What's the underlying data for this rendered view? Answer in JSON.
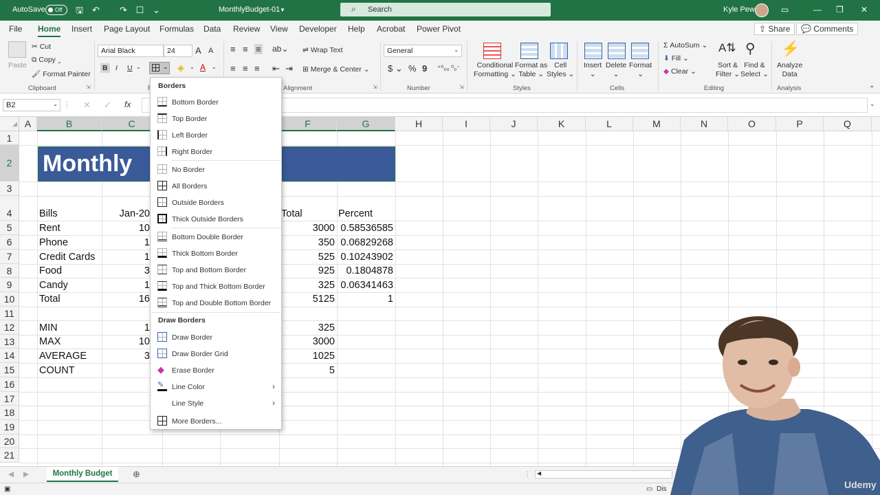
{
  "titlebar": {
    "autosave_label": "AutoSave",
    "autosave_state": "Off",
    "doc_title": "MonthlyBudget-01",
    "search_placeholder": "Search",
    "user": "Kyle Pew"
  },
  "tabs": [
    "File",
    "Home",
    "Insert",
    "Page Layout",
    "Formulas",
    "Data",
    "Review",
    "View",
    "Developer",
    "Help",
    "Acrobat",
    "Power Pivot"
  ],
  "active_tab": "Home",
  "share_label": "Share",
  "comments_label": "Comments",
  "ribbon": {
    "clipboard": {
      "paste": "Paste",
      "cut": "Cut",
      "copy": "Copy",
      "format_painter": "Format Painter",
      "group": "Clipboard"
    },
    "font": {
      "name": "Arial Black",
      "size": "24",
      "group": "F"
    },
    "alignment": {
      "wrap": "Wrap Text",
      "merge": "Merge & Center",
      "group": "Alignment"
    },
    "number": {
      "format": "General",
      "group": "Number"
    },
    "styles": {
      "conditional": "Conditional Formatting",
      "format_table": "Format as Table",
      "cell_styles": "Cell Styles",
      "group": "Styles"
    },
    "cells": {
      "insert": "Insert",
      "delete": "Delete",
      "format": "Format",
      "group": "Cells"
    },
    "editing": {
      "autosum": "AutoSum",
      "fill": "Fill",
      "clear": "Clear",
      "sort": "Sort & Filter",
      "find": "Find & Select",
      "group": "Editing"
    },
    "analysis": {
      "analyze": "Analyze Data",
      "group": "Analysis"
    }
  },
  "namebox": "B2",
  "columns": [
    "A",
    "B",
    "C",
    "F",
    "G",
    "H",
    "I",
    "J",
    "K",
    "L",
    "M",
    "N",
    "O",
    "P",
    "Q"
  ],
  "rows": [
    "1",
    "2",
    "3",
    "4",
    "5",
    "6",
    "7",
    "8",
    "9",
    "10",
    "11",
    "12",
    "13",
    "14",
    "15",
    "16",
    "17",
    "18",
    "19",
    "20",
    "21"
  ],
  "banner_text": "Monthly",
  "cells": {
    "header": {
      "b": "Bills",
      "c": "Jan-20",
      "f": "Total",
      "g": "Percent"
    },
    "rows": [
      {
        "b": "Rent",
        "c": "10",
        "f": "3000",
        "g": "0.58536585"
      },
      {
        "b": "Phone",
        "c": "1",
        "f": "350",
        "g": "0.06829268"
      },
      {
        "b": "Credit Cards",
        "c": "1",
        "f": "525",
        "g": "0.10243902"
      },
      {
        "b": "Food",
        "c": "3",
        "f": "925",
        "g": "0.1804878"
      },
      {
        "b": "Candy",
        "c": "1",
        "f": "325",
        "g": "0.06341463"
      },
      {
        "b": "Total",
        "c": "16",
        "f": "5125",
        "g": "1"
      }
    ],
    "stats": [
      {
        "b": "MIN",
        "c": "1",
        "f": "325"
      },
      {
        "b": "MAX",
        "c": "10",
        "f": "3000"
      },
      {
        "b": "AVERAGE",
        "c": "3",
        "f": "1025"
      },
      {
        "b": "COUNT",
        "c": "",
        "f": "5"
      }
    ]
  },
  "borders_menu": {
    "title": "Borders",
    "items": [
      "Bottom Border",
      "Top Border",
      "Left Border",
      "Right Border",
      "No Border",
      "All Borders",
      "Outside Borders",
      "Thick Outside Borders",
      "Bottom Double Border",
      "Thick Bottom Border",
      "Top and Bottom Border",
      "Top and Thick Bottom Border",
      "Top and Double Bottom Border"
    ],
    "draw_title": "Draw Borders",
    "draw_items": [
      "Draw Border",
      "Draw Border Grid",
      "Erase Border",
      "Line Color",
      "Line Style",
      "More Borders..."
    ]
  },
  "sheet_tab": "Monthly Budget",
  "status_partial": "Dis",
  "watermark": "Udemy",
  "colors": {
    "excel_green": "#217346",
    "banner_fill": "#3a5a99"
  }
}
